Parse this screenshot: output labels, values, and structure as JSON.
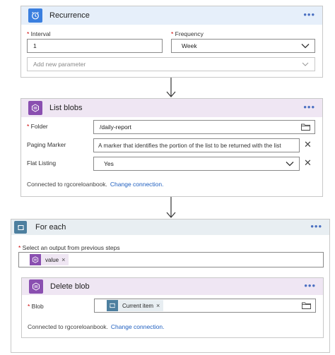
{
  "recurrence": {
    "title": "Recurrence",
    "more": "•••",
    "interval_label": "Interval",
    "interval_value": "1",
    "frequency_label": "Frequency",
    "frequency_value": "Week",
    "add_param_placeholder": "Add new parameter",
    "accent_color": "#3a7fdf",
    "header_bg": "#e6effa"
  },
  "list_blobs": {
    "title": "List blobs",
    "more": "•••",
    "folder_label": "Folder",
    "folder_value": "/daily-report",
    "paging_label": "Paging Marker",
    "paging_placeholder": "A marker that identifies the portion of the list to be returned with the list",
    "flat_label": "Flat Listing",
    "flat_value": "Yes",
    "connected_text": "Connected to rgcoreloanbook.",
    "change_link": "Change connection.",
    "accent_color": "#8a4fb0",
    "header_bg": "#efe6f3"
  },
  "for_each": {
    "title": "For each",
    "more": "•••",
    "select_label": "Select an output from previous steps",
    "token_label": "value",
    "token_remove": "×",
    "accent_color": "#4d7f9f",
    "header_bg": "#e8eef2"
  },
  "delete_blob": {
    "title": "Delete blob",
    "more": "•••",
    "blob_label": "Blob",
    "token_label": "Current item",
    "token_remove": "×",
    "connected_text": "Connected to rgcoreloanbook.",
    "change_link": "Change connection.",
    "accent_color": "#8a4fb0",
    "header_bg": "#efe6f3"
  },
  "icons": {
    "recurrence": "alarm-clock-icon",
    "blob": "storage-blob-icon",
    "foreach": "loop-icon",
    "folder": "folder-icon",
    "chevron": "chevron-down-icon",
    "clear": "close-icon",
    "arrow": "arrow-down-icon"
  }
}
